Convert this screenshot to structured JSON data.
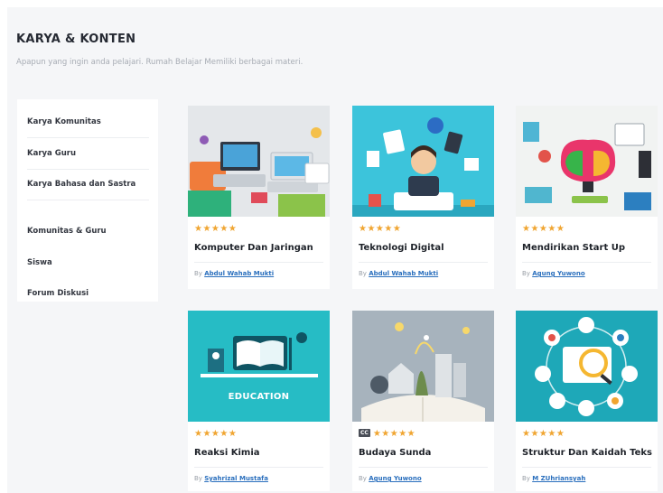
{
  "header": {
    "title": "KARYA & KONTEN",
    "subtitle": "Apapun yang ingin anda pelajari. Rumah Belajar Memiliki berbagai materi."
  },
  "sidebar": {
    "items": [
      {
        "label": "Karya Komunitas"
      },
      {
        "label": "Karya Guru"
      },
      {
        "label": "Karya Bahasa dan Sastra"
      },
      {
        "label": "Komunitas & Guru"
      },
      {
        "label": "Siswa"
      },
      {
        "label": "Forum Diskusi"
      }
    ]
  },
  "cards": [
    {
      "title": "Komputer Dan Jaringan",
      "by": "By",
      "author": "Abdul Wahab Mukti",
      "stars": "★★★★★",
      "badge": ""
    },
    {
      "title": "Teknologi Digital",
      "by": "By",
      "author": "Abdul Wahab Mukti",
      "stars": "★★★★★",
      "badge": ""
    },
    {
      "title": "Mendirikan Start Up",
      "by": "By",
      "author": "Agung Yuwono",
      "stars": "★★★★★",
      "badge": ""
    },
    {
      "title": "Reaksi Kimia",
      "by": "By",
      "author": "Syahrizal Mustafa",
      "stars": "★★★★★",
      "badge": "",
      "thumb_text": "EDUCATION"
    },
    {
      "title": "Budaya Sunda",
      "by": "By",
      "author": "Agung Yuwono",
      "stars": "★★★★★",
      "badge": "CC"
    },
    {
      "title": "Struktur Dan Kaidah Teks",
      "by": "By",
      "author": "M ZUhriansyah",
      "stars": "★★★★★",
      "badge": ""
    }
  ],
  "colors": {
    "star": "#f0a531",
    "link": "#2a6fbd",
    "background": "#f5f6f8"
  }
}
